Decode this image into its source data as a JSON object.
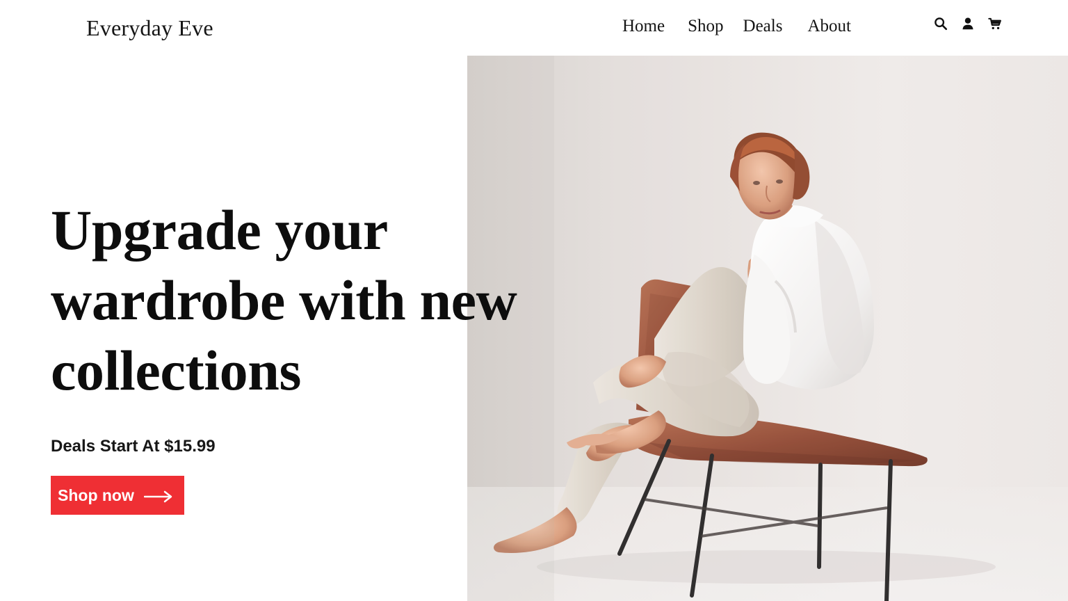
{
  "header": {
    "brand": "Everyday Eve",
    "nav": [
      {
        "label": "Home"
      },
      {
        "label": "Shop"
      },
      {
        "label": "Deals"
      },
      {
        "label": "About"
      }
    ],
    "icons": {
      "search": "search-icon",
      "account": "user-icon",
      "cart": "cart-icon"
    }
  },
  "hero": {
    "headline_lines": [
      "Upgrade your",
      "wardrobe with new",
      "collections"
    ],
    "deal_text": "Deals Start At $15.99",
    "cta_label": "Shop now",
    "cta_icon": "arrow-right-icon",
    "image": "woman-seated-on-chair-photo"
  },
  "colors": {
    "accent": "#ef2f34",
    "text": "#111111",
    "background": "#ffffff",
    "photo_background": "#ebe6e3"
  }
}
